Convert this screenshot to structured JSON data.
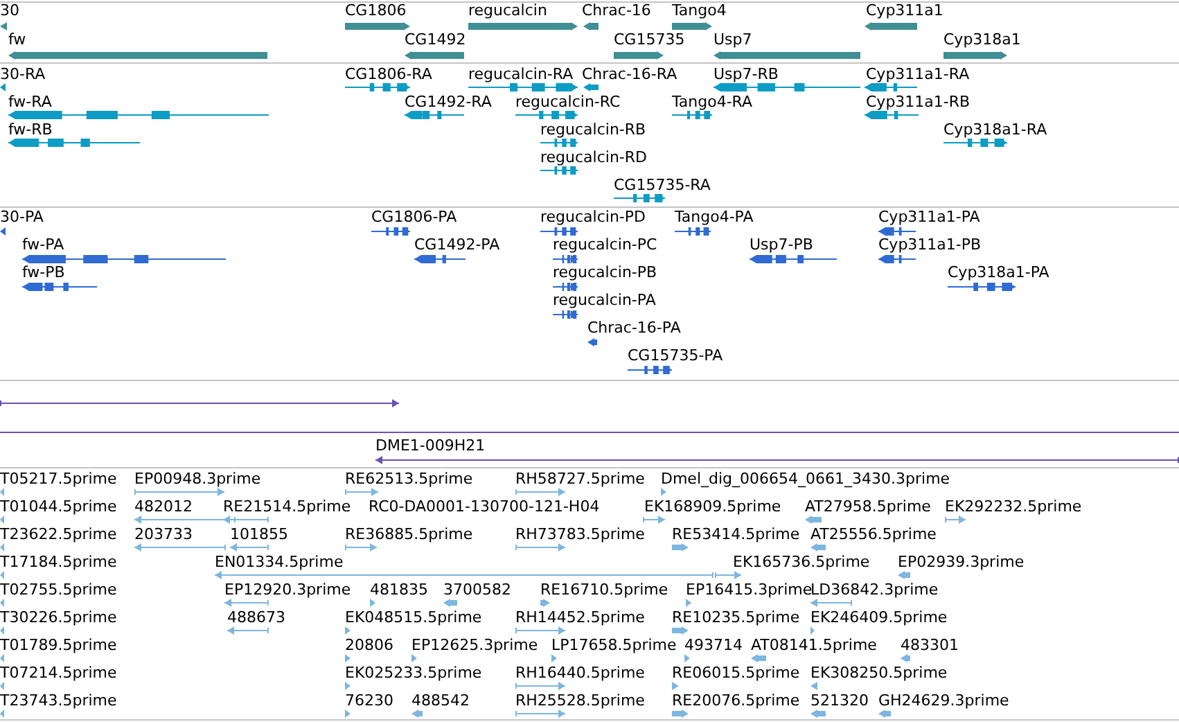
{
  "tracks": [
    {
      "kind": "genes",
      "features": [
        {
          "label": "30",
          "reverse": true
        },
        {
          "label": "CG1806",
          "reverse": false
        },
        {
          "label": "regucalcin",
          "reverse": false
        },
        {
          "label": "Chrac-16",
          "reverse": true
        },
        {
          "label": "Tango4",
          "reverse": false
        },
        {
          "label": "Cyp311a1",
          "reverse": true
        },
        {
          "label": "fw",
          "reverse": true
        },
        {
          "label": "CG1492",
          "reverse": true
        },
        {
          "label": "CG15735",
          "reverse": false
        },
        {
          "label": "Usp7",
          "reverse": true
        },
        {
          "label": "Cyp318a1",
          "reverse": false
        }
      ]
    },
    {
      "kind": "transcripts",
      "features": [
        {
          "label": "30-RA",
          "reverse": true
        },
        {
          "label": "CG1806-RA",
          "reverse": false
        },
        {
          "label": "regucalcin-RA",
          "reverse": false
        },
        {
          "label": "Chrac-16-RA",
          "reverse": true
        },
        {
          "label": "Usp7-RB",
          "reverse": true
        },
        {
          "label": "Cyp311a1-RA",
          "reverse": true
        },
        {
          "label": "fw-RA",
          "reverse": true
        },
        {
          "label": "CG1492-RA",
          "reverse": true
        },
        {
          "label": "regucalcin-RC",
          "reverse": false
        },
        {
          "label": "Tango4-RA",
          "reverse": false
        },
        {
          "label": "Cyp311a1-RB",
          "reverse": true
        },
        {
          "label": "fw-RB",
          "reverse": true
        },
        {
          "label": "regucalcin-RB",
          "reverse": false
        },
        {
          "label": "Cyp318a1-RA",
          "reverse": false
        },
        {
          "label": "regucalcin-RD",
          "reverse": false
        },
        {
          "label": "CG15735-RA",
          "reverse": false
        }
      ]
    },
    {
      "kind": "proteins",
      "features": [
        {
          "label": "30-PA",
          "reverse": true
        },
        {
          "label": "CG1806-PA",
          "reverse": false
        },
        {
          "label": "regucalcin-PD",
          "reverse": false
        },
        {
          "label": "Tango4-PA",
          "reverse": false
        },
        {
          "label": "Cyp311a1-PA",
          "reverse": true
        },
        {
          "label": "fw-PA",
          "reverse": true
        },
        {
          "label": "CG1492-PA",
          "reverse": true
        },
        {
          "label": "regucalcin-PC",
          "reverse": false
        },
        {
          "label": "Usp7-PB",
          "reverse": true
        },
        {
          "label": "Cyp311a1-PB",
          "reverse": true
        },
        {
          "label": "fw-PB",
          "reverse": true
        },
        {
          "label": "regucalcin-PB",
          "reverse": false
        },
        {
          "label": "Cyp318a1-PA",
          "reverse": false
        },
        {
          "label": "regucalcin-PA",
          "reverse": false
        },
        {
          "label": "Chrac-16-PA",
          "reverse": true
        },
        {
          "label": "CG15735-PA",
          "reverse": false
        }
      ]
    },
    {
      "kind": "clones",
      "features": [
        {
          "reverse": false
        },
        {
          "arrowhead": false
        },
        {
          "label": "DME1-009H21",
          "reverse": true
        }
      ]
    },
    {
      "kind": "ests",
      "features": [
        {
          "label": "T05217.5prime",
          "reverse": true
        },
        {
          "label": "EP00948.3prime",
          "reverse": false
        },
        {
          "label": "RE62513.5prime",
          "reverse": false
        },
        {
          "label": "RH58727.5prime",
          "reverse": false
        },
        {
          "label": "Dmel_dig_006654_0661_3430.3prime",
          "reverse": false
        },
        {
          "label": "T01044.5prime",
          "reverse": true
        },
        {
          "label": "482012",
          "reverse": true
        },
        {
          "label": "RE21514.5prime",
          "reverse": true
        },
        {
          "label": "RC0-DA0001-130700-121-H04"
        },
        {
          "label": "EK168909.5prime",
          "reverse": false
        },
        {
          "label": "AT27958.5prime",
          "reverse": true
        },
        {
          "label": "EK292232.5prime",
          "reverse": false
        },
        {
          "label": "T23622.5prime",
          "reverse": true
        },
        {
          "label": "203733",
          "reverse": true
        },
        {
          "label": "101855",
          "reverse": true
        },
        {
          "label": "RE36885.5prime",
          "reverse": false
        },
        {
          "label": "RH73783.5prime",
          "reverse": false
        },
        {
          "label": "RE53414.5prime",
          "reverse": false
        },
        {
          "label": "AT25556.5prime",
          "reverse": true
        },
        {
          "label": "T17184.5prime",
          "reverse": true
        },
        {
          "label": "EN01334.5prime",
          "reverse": true
        },
        {
          "label": "EK165736.5prime",
          "reverse": false
        },
        {
          "label": "EP02939.3prime",
          "reverse": true
        },
        {
          "label": "T02755.5prime",
          "reverse": true
        },
        {
          "label": "EP12920.3prime",
          "reverse": true
        },
        {
          "label": "481835",
          "reverse": false
        },
        {
          "label": "3700582",
          "reverse": true
        },
        {
          "label": "RE16710.5prime",
          "reverse": false
        },
        {
          "label": "EP16415.3prime",
          "reverse": false
        },
        {
          "label": "LD36842.3prime",
          "reverse": true
        },
        {
          "label": "T30226.5prime",
          "reverse": true
        },
        {
          "label": "488673",
          "reverse": true
        },
        {
          "label": "EK048515.5prime",
          "reverse": false
        },
        {
          "label": "RH14452.5prime",
          "reverse": false
        },
        {
          "label": "RE10235.5prime",
          "reverse": false
        },
        {
          "label": "EK246409.5prime",
          "reverse": false
        },
        {
          "label": "T01789.5prime",
          "reverse": true
        },
        {
          "label": "20806",
          "reverse": false
        },
        {
          "label": "EP12625.3prime",
          "reverse": false
        },
        {
          "label": "LP17658.5prime",
          "reverse": false
        },
        {
          "label": "493714",
          "reverse": false
        },
        {
          "label": "AT08141.5prime",
          "reverse": true
        },
        {
          "label": "483301",
          "reverse": true
        },
        {
          "label": "T07214.5prime",
          "reverse": true
        },
        {
          "label": "EK025233.5prime",
          "reverse": false
        },
        {
          "label": "RH16440.5prime",
          "reverse": false
        },
        {
          "label": "RE06015.5prime",
          "reverse": false
        },
        {
          "label": "EK308250.5prime",
          "reverse": true
        },
        {
          "label": "T23743.5prime",
          "reverse": true
        },
        {
          "label": "76230",
          "reverse": false
        },
        {
          "label": "488542",
          "reverse": true
        },
        {
          "label": "RH25528.5prime",
          "reverse": false
        },
        {
          "label": "RE20076.5prime",
          "reverse": false
        },
        {
          "label": "521320",
          "reverse": true
        },
        {
          "label": "GH24629.3prime",
          "reverse": true
        }
      ]
    }
  ]
}
